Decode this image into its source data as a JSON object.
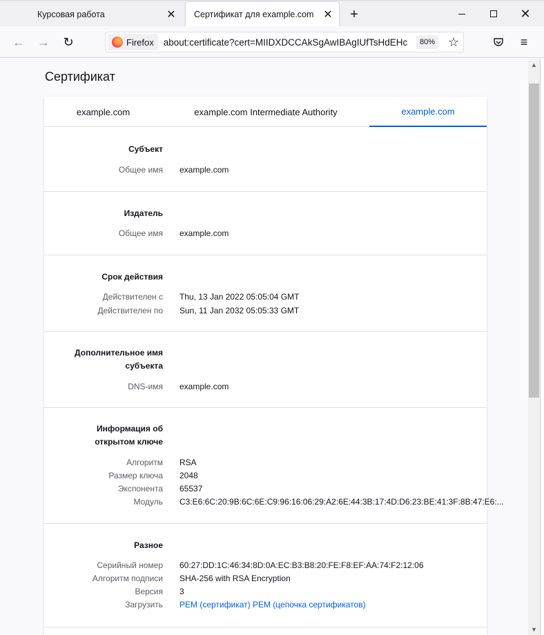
{
  "tabs": {
    "inactive_label": "Курсовая работа",
    "active_label": "Сертификат для example.com",
    "close_glyph": "✕",
    "new_tab_glyph": "+"
  },
  "window": {
    "minimize": "",
    "maximize": "",
    "close": "✕"
  },
  "nav": {
    "back_glyph": "←",
    "forward_glyph": "→",
    "reload_glyph": "↻",
    "identity_label": "Firefox",
    "url": "about:certificate?cert=MIIDXDCCAkSgAwIBAgIUfTsHdEHc",
    "zoom": "80%",
    "star_glyph": "☆",
    "menu_glyph": "≡"
  },
  "page": {
    "title": "Сертификат",
    "cert_tabs": [
      "example.com",
      "example.com Intermediate Authority",
      "example.com"
    ]
  },
  "sections": {
    "subject": {
      "title": "Субъект",
      "rows": [
        {
          "label": "Общее имя",
          "value": "example.com"
        }
      ]
    },
    "issuer": {
      "title": "Издатель",
      "rows": [
        {
          "label": "Общее имя",
          "value": "example.com"
        }
      ]
    },
    "validity": {
      "title": "Срок действия",
      "rows": [
        {
          "label": "Действителен с",
          "value": "Thu, 13 Jan 2022 05:05:04 GMT"
        },
        {
          "label": "Действителен по",
          "value": "Sun, 11 Jan 2032 05:05:33 GMT"
        }
      ]
    },
    "san": {
      "title_line1": "Дополнительное имя",
      "title_line2": "субъекта",
      "rows": [
        {
          "label": "DNS-имя",
          "value": "example.com"
        }
      ]
    },
    "public_key": {
      "title_line1": "Информация об",
      "title_line2": "открытом ключе",
      "rows": [
        {
          "label": "Алгоритм",
          "value": "RSA"
        },
        {
          "label": "Размер ключа",
          "value": "2048"
        },
        {
          "label": "Экспонента",
          "value": "65537"
        },
        {
          "label": "Модуль",
          "value": "C3:E6:6C:20:9B:6C:6E:C9:96:16:06:29:A2:6E:44:3B:17:4D:D6:23:BE:41:3F:8B:47:E6:..."
        }
      ]
    },
    "misc": {
      "title": "Разное",
      "rows": [
        {
          "label": "Серийный номер",
          "value": "60:27:DD:1C:46:34:8D:0A:EC:B3:B8:20:FE:F8:EF:AA:74:F2:12:06"
        },
        {
          "label": "Алгоритм подписи",
          "value": "SHA-256 with RSA Encryption"
        },
        {
          "label": "Версия",
          "value": "3"
        }
      ],
      "download_label": "Загрузить",
      "download_links": [
        "PEM (сертификат)",
        "PEM (цепочка сертификатов)"
      ]
    }
  },
  "colors": {
    "accent": "#0060df",
    "label_gray": "#5b5b66"
  }
}
